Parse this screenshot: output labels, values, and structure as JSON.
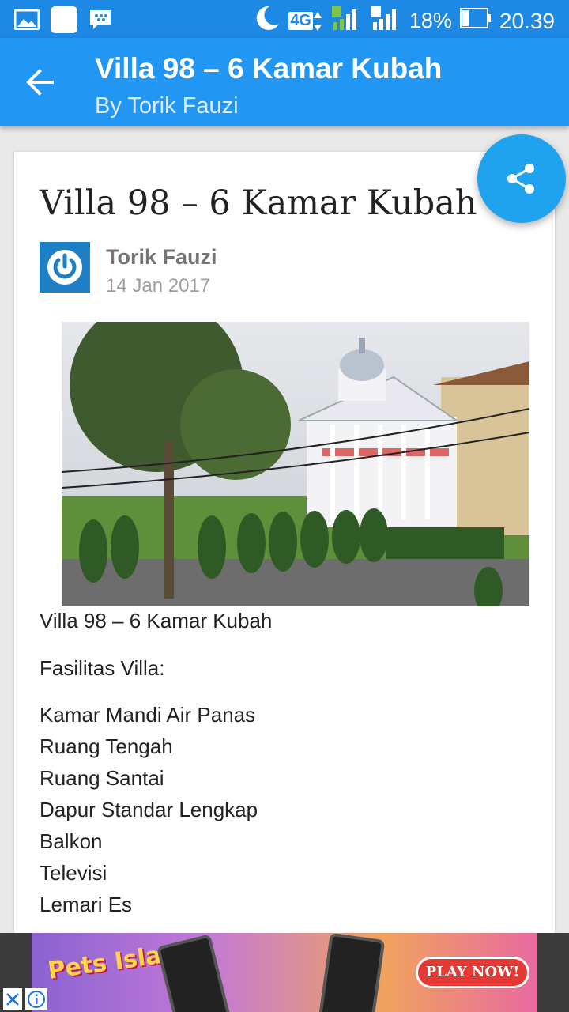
{
  "status_bar": {
    "battery": "18%",
    "time": "20.39",
    "network": "4G",
    "sim1": "1",
    "sim2": "2"
  },
  "app_bar": {
    "title": "Villa 98 – 6 Kamar Kubah",
    "subtitle": "By Torik Fauzi"
  },
  "post": {
    "title": "Villa 98 – 6 Kamar Kubah",
    "author": "Torik Fauzi",
    "date": "14 Jan 2017",
    "caption": "Villa 98 – 6 Kamar Kubah",
    "facilities_heading": "Fasilitas Villa:",
    "facilities": [
      "Kamar Mandi Air Panas",
      "Ruang Tengah",
      "Ruang Santai",
      "Dapur Standar Lengkap",
      "Balkon",
      "Televisi",
      "Lemari Es"
    ]
  },
  "ad": {
    "brand": "Pets Island",
    "cta": "PLAY NOW!"
  },
  "colors": {
    "status_bar": "#1e88e5",
    "app_bar": "#2196f3",
    "fab": "#1fa3ee"
  }
}
